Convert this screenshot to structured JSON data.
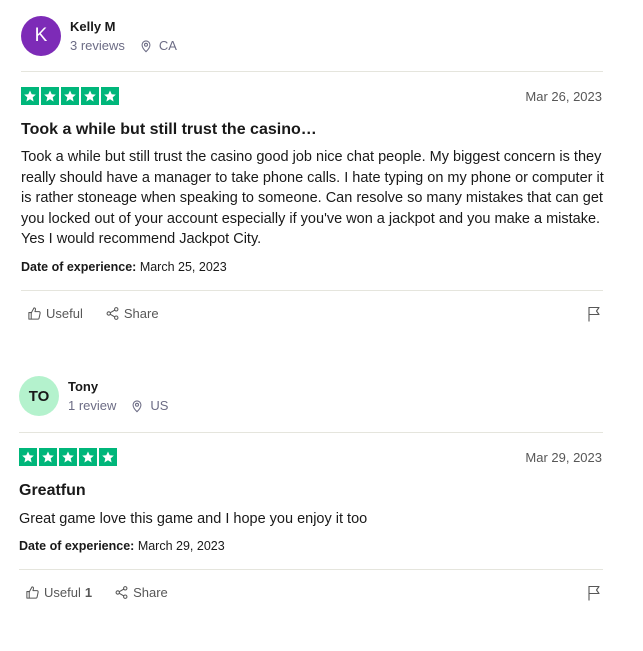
{
  "reviews": [
    {
      "avatar_initials": "K",
      "avatar_color": "#7d2bb7",
      "name": "Kelly M",
      "review_count": "3 reviews",
      "country": "CA",
      "rating": 5,
      "star_color": "#00b67a",
      "date": "Mar 26, 2023",
      "title": "Took a while but still trust the casino…",
      "text": "Took a while but still trust the casino good job nice chat people. My biggest concern is they really should have a manager to take phone calls. I hate typing on my phone or computer it is rather stoneage when speaking to someone. Can resolve so many mistakes that can get you locked out of your account especially if you've won a jackpot and you make a mistake. Yes I would recommend Jackpot City.",
      "experience_label": "Date of experience:",
      "experience_date": "March 25, 2023",
      "useful_label": "Useful",
      "useful_count": "",
      "share_label": "Share"
    },
    {
      "avatar_initials": "TO",
      "avatar_color": "#b4f2cd",
      "name": "Tony",
      "review_count": "1 review",
      "country": "US",
      "rating": 5,
      "star_color": "#00b67a",
      "date": "Mar 29, 2023",
      "title": "Greatfun",
      "text": "Great game love this game and I hope you enjoy it too",
      "experience_label": "Date of experience:",
      "experience_date": "March 29, 2023",
      "useful_label": "Useful",
      "useful_count": "1",
      "share_label": "Share"
    }
  ],
  "icons": {
    "location": "location-pin-icon",
    "useful": "thumbs-up-icon",
    "share": "share-icon",
    "report": "flag-icon",
    "star": "star-icon"
  }
}
